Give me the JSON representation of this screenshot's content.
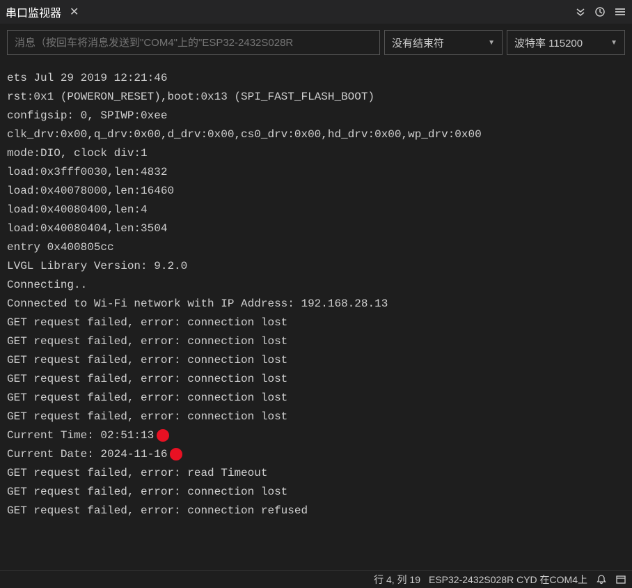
{
  "titlebar": {
    "title": "串口监视器"
  },
  "toolbar": {
    "message_placeholder": "消息（按回车将消息发送到\"COM4\"上的\"ESP32-2432S028R",
    "line_ending": {
      "selected": "没有结束符"
    },
    "baud_rate": {
      "selected": "波特率 115200"
    }
  },
  "console": {
    "lines": [
      "ets Jul 29 2019 12:21:46",
      "",
      "rst:0x1 (POWERON_RESET),boot:0x13 (SPI_FAST_FLASH_BOOT)",
      "configsip: 0, SPIWP:0xee",
      "clk_drv:0x00,q_drv:0x00,d_drv:0x00,cs0_drv:0x00,hd_drv:0x00,wp_drv:0x00",
      "mode:DIO, clock div:1",
      "load:0x3fff0030,len:4832",
      "load:0x40078000,len:16460",
      "load:0x40080400,len:4",
      "load:0x40080404,len:3504",
      "entry 0x400805cc",
      "LVGL Library Version: 9.2.0",
      "Connecting..",
      "Connected to Wi-Fi network with IP Address: 192.168.28.13",
      "GET request failed, error: connection lost",
      "GET request failed, error: connection lost",
      "GET request failed, error: connection lost",
      "GET request failed, error: connection lost",
      "GET request failed, error: connection lost",
      "GET request failed, error: connection lost",
      "Current Time: 02:51:13",
      "Current Date: 2024-11-16",
      "GET request failed, error: read Timeout",
      "GET request failed, error: connection lost",
      "GET request failed, error: connection refused"
    ],
    "red_dot_lines": [
      20,
      21
    ]
  },
  "statusbar": {
    "cursor_position": "行 4, 列 19",
    "device_info": "ESP32-2432S028R CYD 在COM4上"
  }
}
